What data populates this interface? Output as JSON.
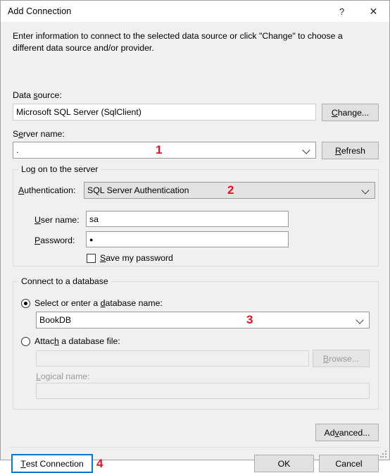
{
  "window": {
    "title": "Add Connection",
    "help_icon": "?",
    "close_icon": "✕"
  },
  "description": "Enter information to connect to the selected data source or click \"Change\" to choose a different data source and/or provider.",
  "data_source": {
    "label_pre": "Data ",
    "label_accel": "s",
    "label_post": "ource:",
    "value": "Microsoft SQL Server (SqlClient)",
    "change_button": {
      "pre": "",
      "accel": "C",
      "post": "hange..."
    }
  },
  "server_name": {
    "label_pre": "S",
    "label_accel": "e",
    "label_post": "rver name:",
    "value": ".",
    "refresh_button": {
      "pre": "",
      "accel": "R",
      "post": "efresh"
    },
    "annotation": "1"
  },
  "logon_group": {
    "legend": "Log on to the server",
    "authentication": {
      "label_pre": "",
      "label_accel": "A",
      "label_post": "uthentication:",
      "value": "SQL Server Authentication",
      "annotation": "2"
    },
    "username": {
      "label_pre": "",
      "label_accel": "U",
      "label_post": "ser name:",
      "value": "sa"
    },
    "password": {
      "label_pre": "",
      "label_accel": "P",
      "label_post": "assword:",
      "value": "●"
    },
    "save_password": {
      "label_pre": "",
      "label_accel": "S",
      "label_post": "ave my password",
      "checked": false
    }
  },
  "database_group": {
    "legend": "Connect to a database",
    "select_database": {
      "label_pre": "Select or enter a ",
      "label_accel": "d",
      "label_post": "atabase name:",
      "selected": true,
      "value": "BookDB",
      "annotation": "3"
    },
    "attach_database": {
      "label_pre": "Attac",
      "label_accel": "h",
      "label_post": " a database file:",
      "selected": false,
      "value": "",
      "browse_button": {
        "pre": "",
        "accel": "B",
        "post": "rowse..."
      }
    },
    "logical_name": {
      "label_pre": "",
      "label_accel": "L",
      "label_post": "ogical name:",
      "value": ""
    }
  },
  "footer": {
    "advanced_button": {
      "pre": "Ad",
      "accel": "v",
      "post": "anced..."
    },
    "test_connection_button": {
      "pre": "",
      "accel": "T",
      "post": "est Connection"
    },
    "test_connection_annotation": "4",
    "ok_button": "OK",
    "cancel_button": "Cancel"
  },
  "colors": {
    "dialog_bg": "#f0f0f0",
    "titlebar_bg": "#ffffff",
    "button_bg": "#e1e1e1",
    "focus_border": "#0078d7",
    "annotation_red": "#e81123",
    "disabled_text": "#9a9a9a"
  }
}
